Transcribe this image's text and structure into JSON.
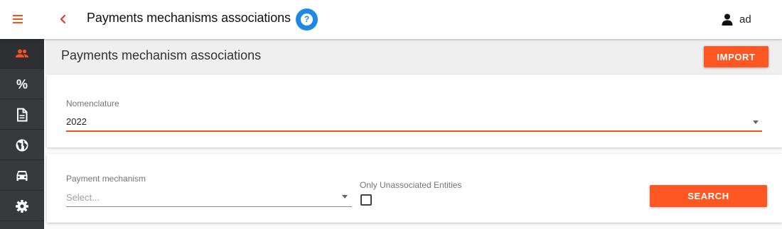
{
  "header": {
    "title": "Payments mechanisms associations",
    "help_label": "?",
    "back_label": "‹",
    "user_name": "ad"
  },
  "sidebar": {
    "items": [
      {
        "icon": "people-icon",
        "active": true
      },
      {
        "icon": "percent-icon",
        "label": "%"
      },
      {
        "icon": "document-icon"
      },
      {
        "icon": "globe-icon"
      },
      {
        "icon": "car-icon"
      },
      {
        "icon": "gear-icon"
      }
    ]
  },
  "section": {
    "title": "Payments mechanism associations",
    "import_label": "IMPORT"
  },
  "filters": {
    "nomenclature_label": "Nomenclature",
    "nomenclature_value": "2022",
    "payment_mechanism_label": "Payment mechanism",
    "payment_mechanism_placeholder": "Select...",
    "only_unassociated_label": "Only Unassociated Entities",
    "only_unassociated_checked": false,
    "search_label": "SEARCH"
  },
  "colors": {
    "accent": "#ff5722",
    "menu_accent": "#f4511e",
    "sidebar_bg": "#37393d",
    "help_blue": "#1e88e5"
  }
}
